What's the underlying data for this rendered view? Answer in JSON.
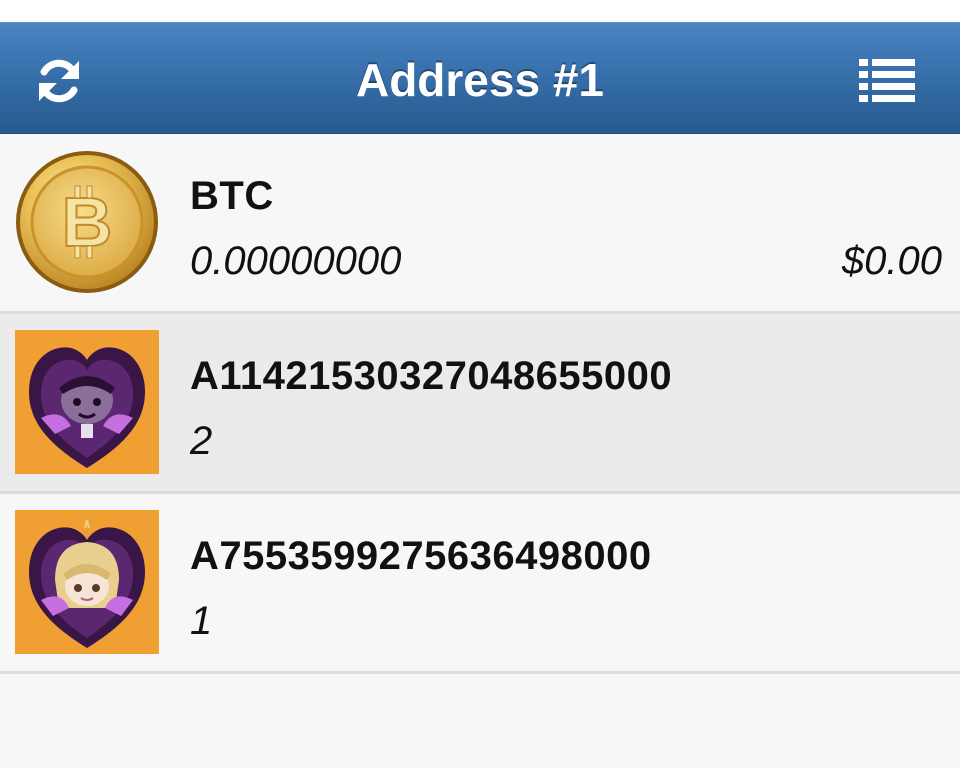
{
  "header": {
    "title": "Address #1",
    "left_icon": "refresh-icon",
    "right_icon": "list-icon",
    "bar_color": "#356ea9"
  },
  "assets": [
    {
      "icon": "bitcoin-coin-icon",
      "name": "BTC",
      "quantity": "0.00000000",
      "value": "$0.00"
    },
    {
      "icon": "anime-token-icon",
      "name": "A11421530327048655000",
      "quantity": "2"
    },
    {
      "icon": "anime-token-icon",
      "name": "A7553599275636498000",
      "quantity": "1"
    }
  ],
  "colors": {
    "token_background": "#f0a033",
    "coin_gold": "#e9b949"
  }
}
